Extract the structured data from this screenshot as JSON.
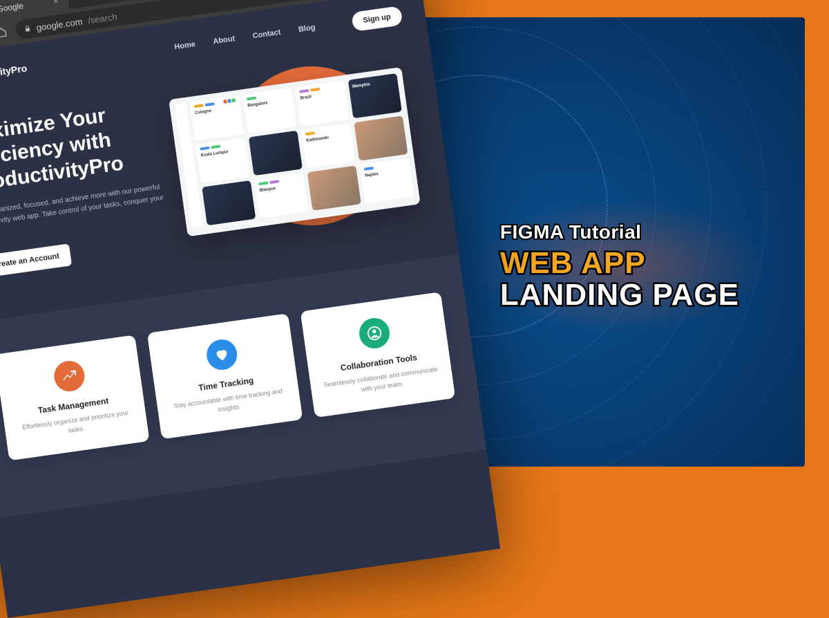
{
  "overlay": {
    "line1": "FIGMA Tutorial",
    "line2": "WEB APP",
    "line3": "LANDING PAGE"
  },
  "browser": {
    "tab_title": "Google",
    "url_domain": "google.com",
    "url_path": "/search"
  },
  "nav": {
    "logo": "ProductivityPro",
    "links": [
      "Home",
      "About",
      "Contact",
      "Blog"
    ],
    "signup": "Sign up"
  },
  "hero": {
    "headline_l1": "Maximize Your",
    "headline_l2": "Efficiency with",
    "headline_l3": "ProductivityPro",
    "sub": "Stay organized, focused, and achieve more with our powerful productivity web app. Take control of your tasks, conquer your goals.",
    "cta": "Create an Account"
  },
  "mock_cards": [
    "Cologne",
    "Bangalore",
    "Brazil",
    "Memphis",
    "Kuala Lumpur",
    "",
    "Kathmandu",
    "",
    "",
    "",
    "Bilaspur",
    "",
    "Naples",
    "",
    "",
    ""
  ],
  "features": [
    {
      "title": "Task Management",
      "desc": "Effortlessly organize and prioritize your tasks.",
      "color": "orange"
    },
    {
      "title": "Time Tracking",
      "desc": "Stay accountable with time tracking and insights.",
      "color": "blue"
    },
    {
      "title": "Collaboration Tools",
      "desc": "Seamlessly collaborate and communicate with your team.",
      "color": "green"
    }
  ]
}
